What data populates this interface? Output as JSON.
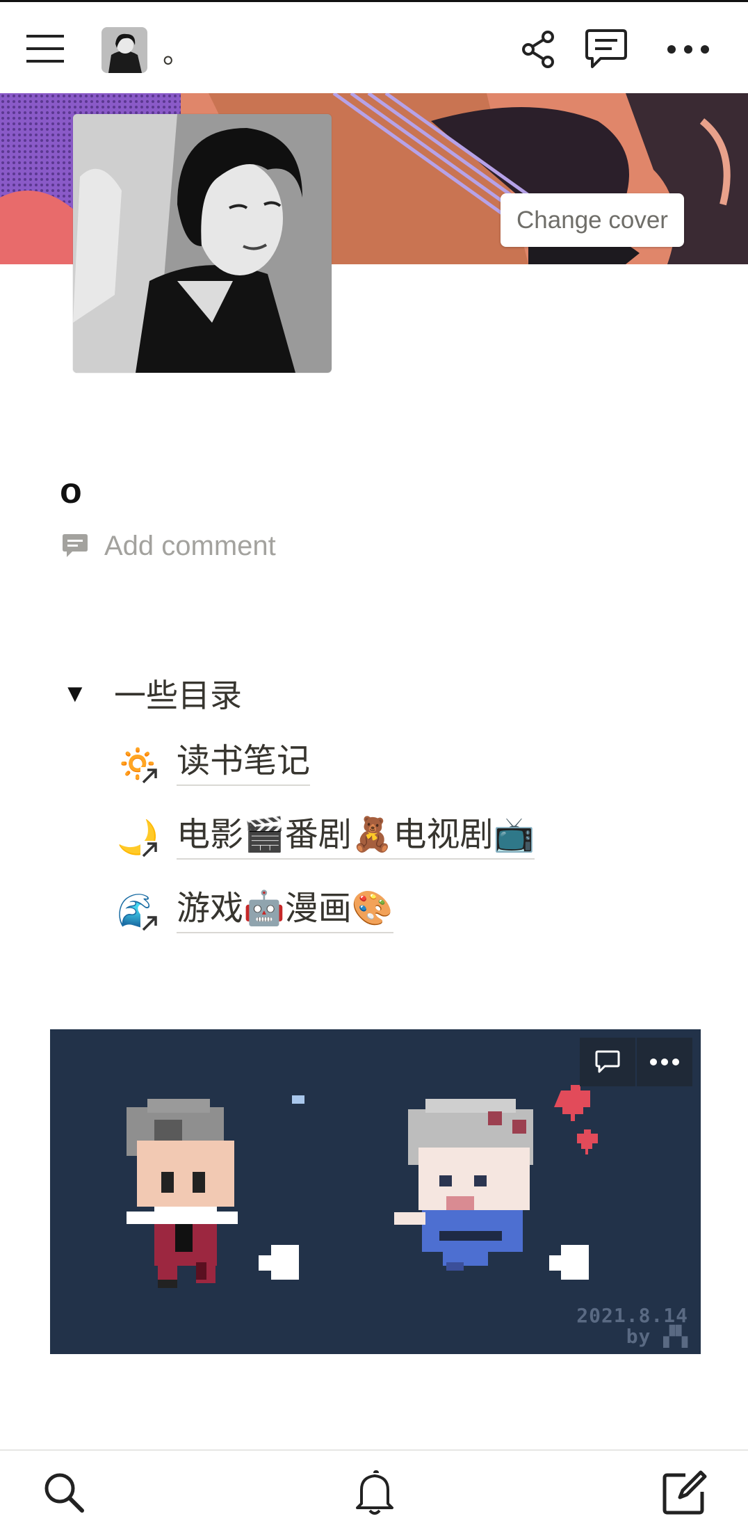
{
  "topbar": {
    "page_title": "。",
    "icons": [
      "menu-icon",
      "share-icon",
      "comments-icon",
      "more-icon"
    ]
  },
  "cover": {
    "change_cover_label": "Change cover"
  },
  "page": {
    "title": "o",
    "add_comment_label": "Add comment"
  },
  "toggle": {
    "label": "一些目录",
    "links": [
      {
        "emoji": "🔅",
        "text": "读书笔记"
      },
      {
        "emoji": "🌙",
        "text": "电影🎬番剧🧸电视剧📺"
      },
      {
        "emoji": "🌊",
        "text": "游戏🤖漫画🎨"
      }
    ]
  },
  "embed": {
    "watermark_date": "2021.8.14",
    "watermark_by": "by"
  },
  "bottombar": {
    "icons": [
      "search-icon",
      "bell-icon",
      "compose-icon"
    ]
  },
  "colors": {
    "text": "#37352f",
    "muted": "#a3a29e",
    "embed_bg": "#223249"
  }
}
